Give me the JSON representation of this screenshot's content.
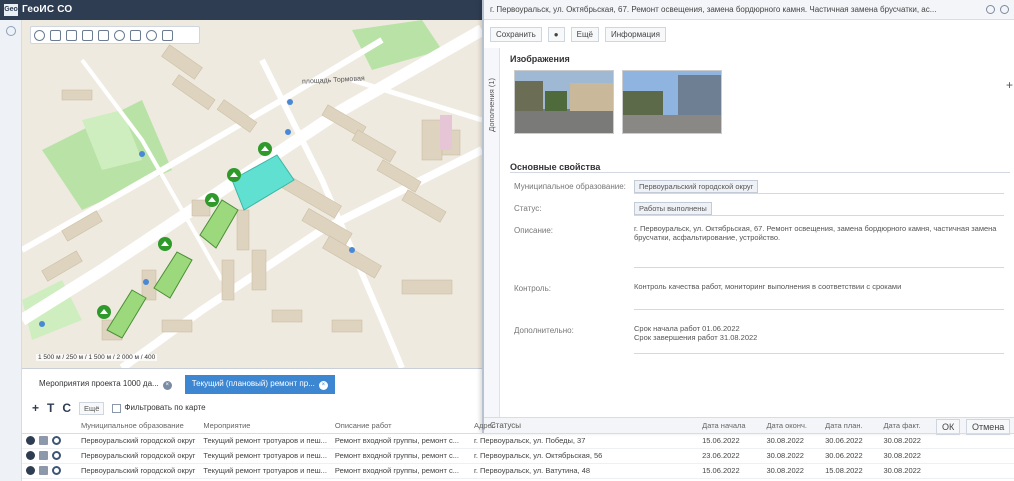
{
  "app": {
    "title": "ГеоИС СО",
    "logo": "Geo"
  },
  "map": {
    "square_label": "площадь Тормовая",
    "scale_text": "1 500 м / 250 м / 1 500 м / 2 000 м / 400",
    "toolbar_icons": [
      "home-icon",
      "layers-icon",
      "share-icon",
      "ruler-icon",
      "select-icon",
      "pin-icon",
      "table-icon",
      "globe-icon",
      "print-icon"
    ]
  },
  "bottom": {
    "tabs": [
      {
        "label": "Мероприятия проекта 1000 да..."
      },
      {
        "label": "Текущий (плановый) ремонт пр..."
      }
    ],
    "tools": {
      "add": "+",
      "filter": "T",
      "refresh": "C",
      "more": "Ещё",
      "toggle_label": "Фильтровать по карте"
    }
  },
  "detail": {
    "title": "г. Первоуральск, ул. Октябрьская, 67. Ремонт освещения, замена бордюрного камня. Частичная замена брусчатки, ас...",
    "toolbar": {
      "save": "Сохранить",
      "locate": "",
      "more": "Ещё",
      "history": "Информация"
    },
    "side_tab": "Дополнения (1)",
    "images_label": "Изображения",
    "props_label": "Основные свойства",
    "fields": {
      "municipality_label": "Муниципальное образование:",
      "municipality_value": "Первоуральский городской округ",
      "status_label": "Статус:",
      "status_value": "Работы выполнены",
      "description_label": "Описание:",
      "description_value": "г. Первоуральск, ул. Октябрьская, 67. Ремонт освещения, замена бордюрного камня, частичная замена брусчатки, асфальтирование, устройство.",
      "control_label": "Контроль:",
      "control_value": "Контроль качества работ, мониторинг выполнения в соответствии с сроками",
      "extra_label": "Дополнительно:",
      "extra_value_1": "Срок начала работ 01.06.2022",
      "extra_value_2": "Срок завершения работ 31.08.2022"
    },
    "footer": {
      "status": "Статусы",
      "ok": "ОК",
      "cancel": "Отмена"
    }
  },
  "table": {
    "headers": [
      "Муниципальное образование",
      "Мероприятие",
      "Описание работ",
      "Адрес",
      "Дата начала",
      "Дата оконч.",
      "Дата план.",
      "Дата факт."
    ],
    "rows": [
      {
        "mo": "Первоуральский городской округ",
        "event": "Текущий ремонт тротуаров и пеш...",
        "desc": "Ремонт входной группы, ремонт с...",
        "addr": "г. Первоуральск, ул. Победы, 37",
        "d1": "15.06.2022",
        "d2": "30.08.2022",
        "d3": "30.06.2022",
        "d4": "30.08.2022"
      },
      {
        "mo": "Первоуральский городской округ",
        "event": "Текущий ремонт тротуаров и пеш...",
        "desc": "Ремонт входной группы, ремонт с...",
        "addr": "г. Первоуральск, ул. Октябрьская, 56",
        "d1": "23.06.2022",
        "d2": "30.08.2022",
        "d3": "30.06.2022",
        "d4": "30.08.2022"
      },
      {
        "mo": "Первоуральский городской округ",
        "event": "Текущий ремонт тротуаров и пеш...",
        "desc": "Ремонт входной группы, ремонт с...",
        "addr": "г. Первоуральск, ул. Ватутина, 48",
        "d1": "15.06.2022",
        "d2": "30.08.2022",
        "d3": "15.08.2022",
        "d4": "30.08.2022"
      }
    ]
  },
  "colors": {
    "header": "#2f3d53",
    "accent": "#3d86d1",
    "selection": "#5fe0d0",
    "park": "#b9e3a6",
    "building": "#ddd3be",
    "road": "#ffffff"
  }
}
